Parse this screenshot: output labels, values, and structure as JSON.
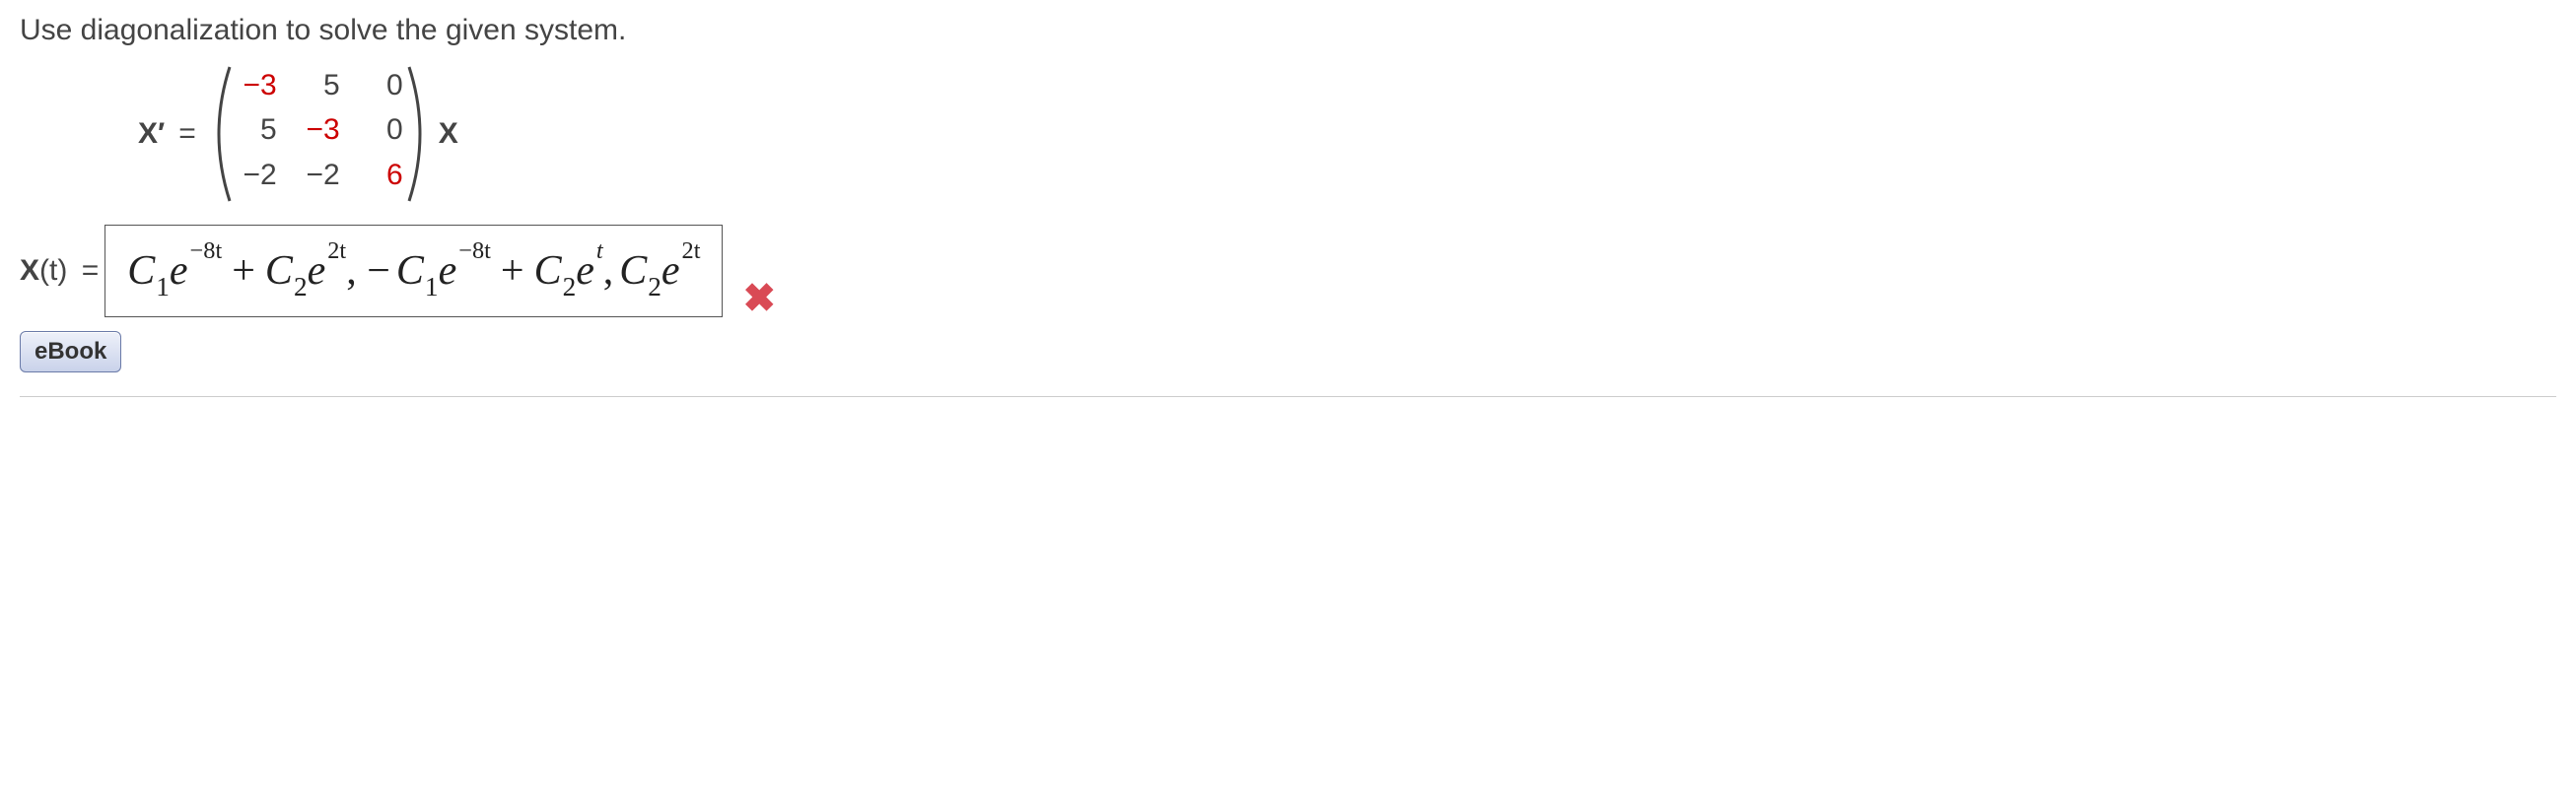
{
  "question": "Use diagonalization to solve the given system.",
  "system": {
    "lhs": "X′",
    "equals": "=",
    "matrix": [
      [
        "−3",
        "5",
        "0"
      ],
      [
        "5",
        "−3",
        "0"
      ],
      [
        "−2",
        "−2",
        "6"
      ]
    ],
    "trail": "X"
  },
  "answer": {
    "label": "X",
    "label_arg": "(t)",
    "equals": "=",
    "expression": {
      "c_label": "C",
      "e_label": "e",
      "terms": [
        {
          "sign": "",
          "c_sub": "1",
          "exp": "−8t"
        },
        {
          "sign": "+",
          "c_sub": "2",
          "exp": "2t"
        },
        {
          "sign": ", −",
          "c_sub": "1",
          "exp": "−8t"
        },
        {
          "sign": "+",
          "c_sub": "2",
          "exp": "t"
        },
        {
          "sign": ",",
          "c_sub": "2",
          "exp": "2t"
        }
      ]
    }
  },
  "status_icon": "✖",
  "ebook_label": "eBook"
}
